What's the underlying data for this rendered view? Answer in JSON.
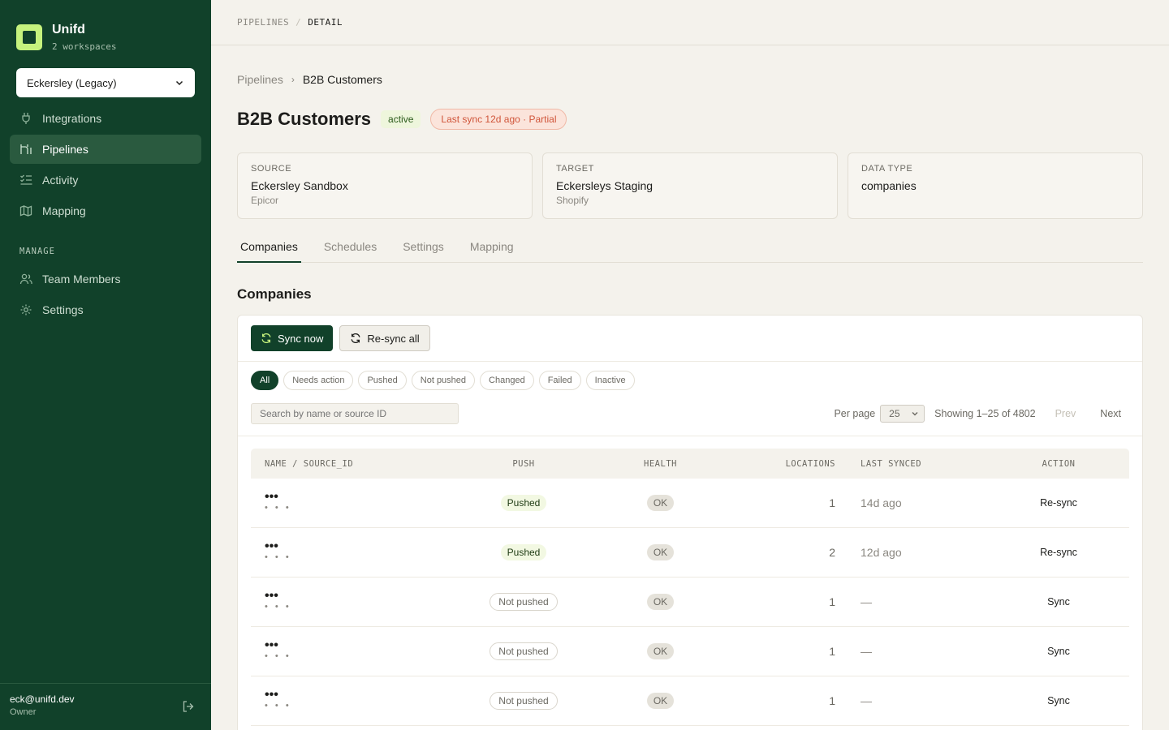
{
  "sidebar": {
    "brand_name": "Unifd",
    "brand_sub": "2 workspaces",
    "workspace": "Eckersley (Legacy)",
    "nav": [
      {
        "label": "Integrations",
        "icon": "plug-icon"
      },
      {
        "label": "Pipelines",
        "icon": "pipeline-icon",
        "active": true
      },
      {
        "label": "Activity",
        "icon": "activity-list-icon"
      },
      {
        "label": "Mapping",
        "icon": "map-icon"
      }
    ],
    "manage_label": "MANAGE",
    "manage": [
      {
        "label": "Team Members",
        "icon": "users-icon"
      },
      {
        "label": "Settings",
        "icon": "gear-icon"
      }
    ],
    "user_email": "eck@unifd.dev",
    "user_role": "Owner"
  },
  "topbar": {
    "crumb_a": "PIPELINES",
    "sep": "/",
    "crumb_b": "DETAIL"
  },
  "breadcrumb": {
    "parent": "Pipelines",
    "current": "B2B Customers"
  },
  "header": {
    "title": "B2B Customers",
    "status": "active",
    "sync_status": "Last sync 12d ago · Partial"
  },
  "cards": [
    {
      "label": "SOURCE",
      "value": "Eckersley Sandbox",
      "sub": "Epicor"
    },
    {
      "label": "TARGET",
      "value": "Eckersleys Staging",
      "sub": "Shopify"
    },
    {
      "label": "DATA TYPE",
      "value": "companies",
      "sub": ""
    }
  ],
  "tabs": [
    "Companies",
    "Schedules",
    "Settings",
    "Mapping"
  ],
  "section_title": "Companies",
  "toolbar": {
    "sync_now": "Sync now",
    "resync_all": "Re-sync all"
  },
  "filters": [
    "All",
    "Needs action",
    "Pushed",
    "Not pushed",
    "Changed",
    "Failed",
    "Inactive"
  ],
  "search": {
    "placeholder": "Search by name or source ID"
  },
  "pager": {
    "per_page_label": "Per page",
    "per_page": "25",
    "showing": "Showing 1–25 of 4802",
    "prev": "Prev",
    "next": "Next"
  },
  "table": {
    "headers": [
      "NAME / SOURCE_ID",
      "PUSH",
      "HEALTH",
      "LOCATIONS",
      "LAST SYNCED",
      "ACTION"
    ],
    "rows": [
      {
        "name": "•••",
        "source_id": "• • •",
        "push": "Pushed",
        "health": "OK",
        "locations": "1",
        "last_synced": "14d ago",
        "action": "Re-sync"
      },
      {
        "name": "•••",
        "source_id": "• • •",
        "push": "Pushed",
        "health": "OK",
        "locations": "2",
        "last_synced": "12d ago",
        "action": "Re-sync"
      },
      {
        "name": "•••",
        "source_id": "• • •",
        "push": "Not pushed",
        "health": "OK",
        "locations": "1",
        "last_synced": "—",
        "action": "Sync"
      },
      {
        "name": "•••",
        "source_id": "• • •",
        "push": "Not pushed",
        "health": "OK",
        "locations": "1",
        "last_synced": "—",
        "action": "Sync"
      },
      {
        "name": "•••",
        "source_id": "• • •",
        "push": "Not pushed",
        "health": "OK",
        "locations": "1",
        "last_synced": "—",
        "action": "Sync"
      }
    ]
  },
  "colors": {
    "sidebar_bg": "#11412a",
    "accent_lime": "#c6f27d",
    "primary": "#11412a",
    "warning": "#d0553a"
  }
}
